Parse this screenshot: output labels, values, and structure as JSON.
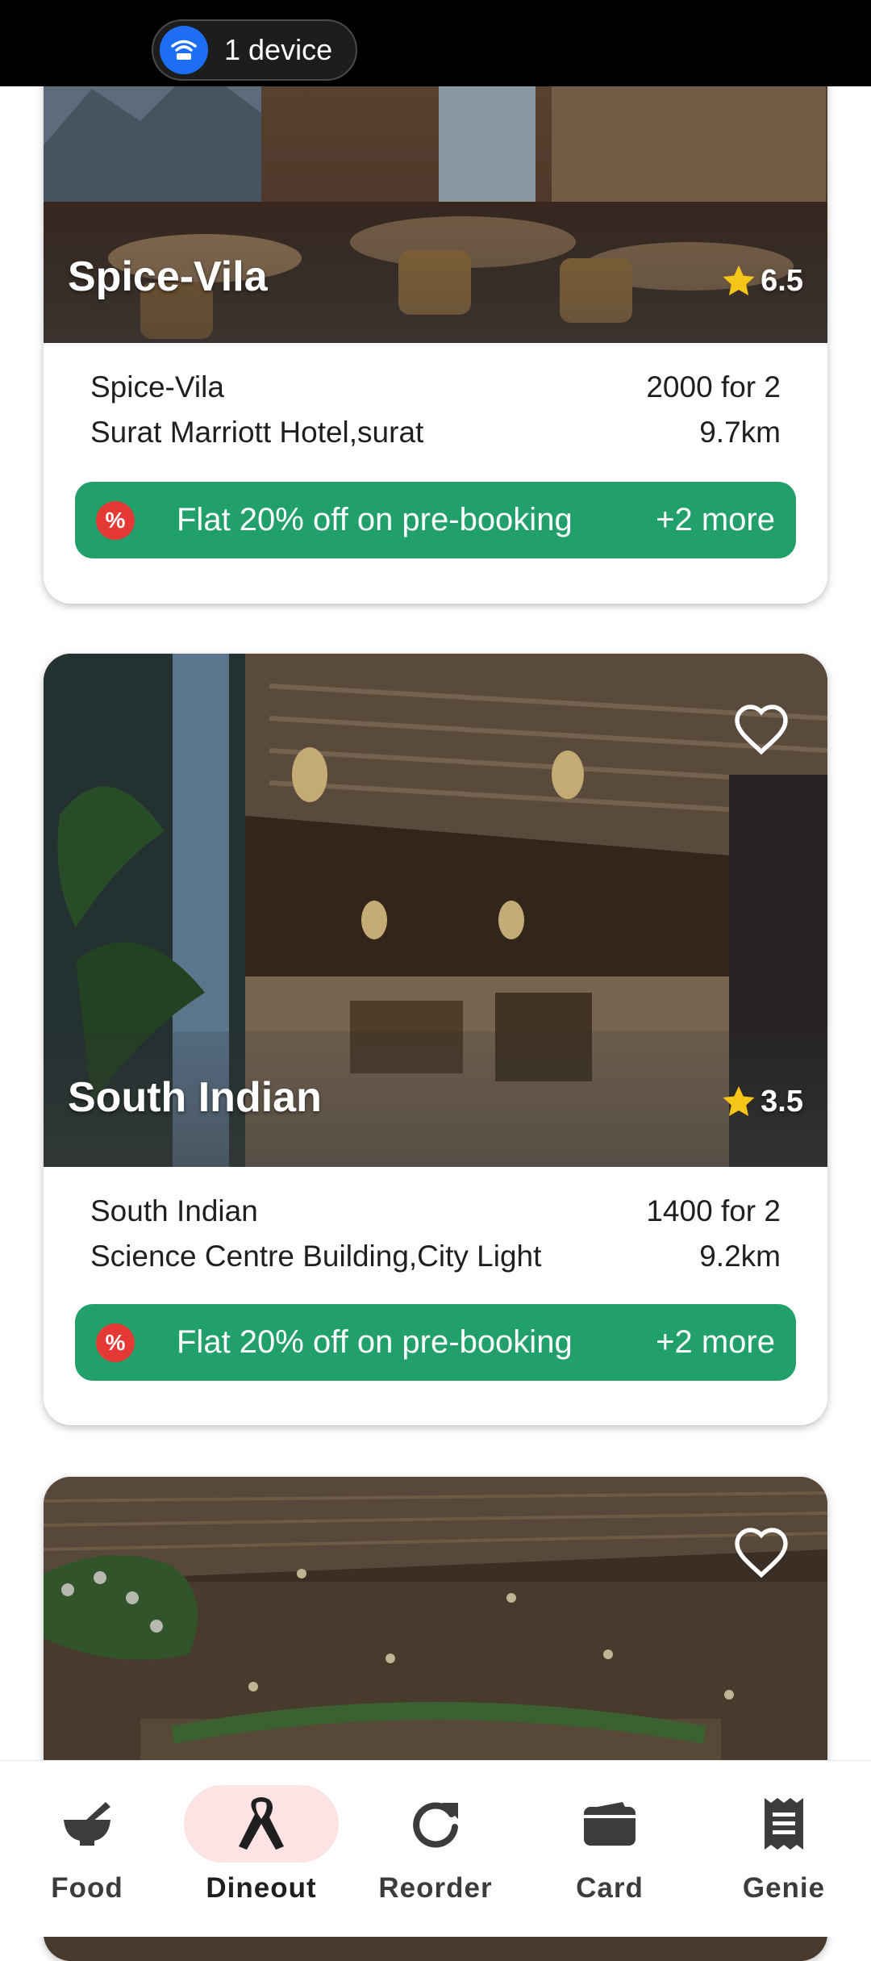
{
  "status_bar": {
    "device_label": "1 device",
    "icon": "wifi-router-icon"
  },
  "restaurants": [
    {
      "title": "Spice-Vila",
      "rating": "6.5",
      "name": "Spice-Vila",
      "price": "2000 for 2",
      "address": "Surat Marriott Hotel,surat",
      "distance": "9.7km",
      "offer_text": "Flat 20% off on pre-booking",
      "offer_more": "+2 more",
      "favorite_icon": "heart-outline-icon"
    },
    {
      "title": "South Indian",
      "rating": "3.5",
      "name": "South Indian",
      "price": "1400 for 2",
      "address": "Science Centre Building,City Light",
      "distance": "9.2km",
      "offer_text": "Flat 20% off on pre-booking",
      "offer_more": "+2 more",
      "favorite_icon": "heart-outline-icon"
    },
    {
      "favorite_icon": "heart-outline-icon"
    }
  ],
  "offer_badge_symbol": "%",
  "bottom_nav": {
    "items": [
      {
        "label": "Food",
        "icon": "mortar-bowl-icon"
      },
      {
        "label": "Dineout",
        "icon": "ribbon-icon",
        "active": true
      },
      {
        "label": "Reorder",
        "icon": "refresh-icon"
      },
      {
        "label": "Card",
        "icon": "wallet-icon"
      },
      {
        "label": "Genie",
        "icon": "receipt-icon"
      }
    ]
  },
  "colors": {
    "offer_green": "#22a06b",
    "percent_red": "#e53935",
    "star_yellow": "#f5c518",
    "active_nav_bg": "#fde3e3"
  }
}
